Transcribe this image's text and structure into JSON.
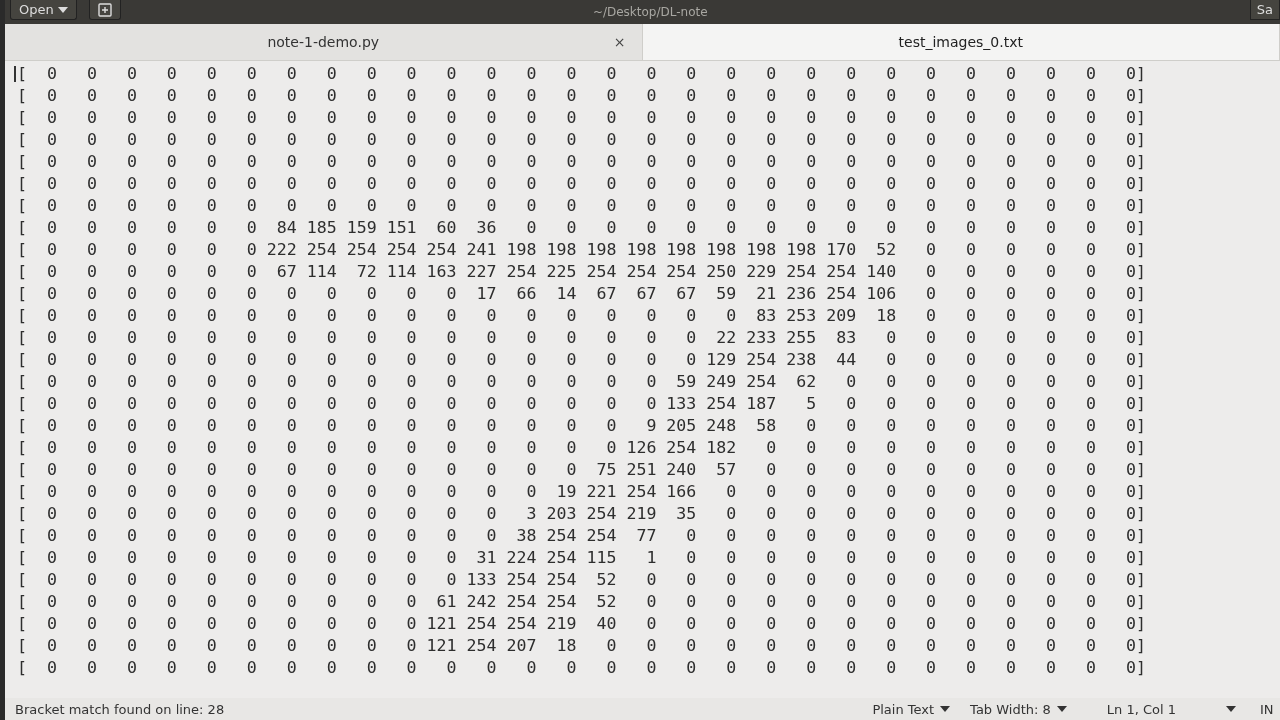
{
  "header": {
    "open_button": "Open",
    "subtitle": "~/Desktop/DL-note",
    "save_button": "Sa"
  },
  "tabs": [
    {
      "label": "note-1-demo.py",
      "close": "×",
      "selected": false
    },
    {
      "label": "test_images_0.txt",
      "selected": true
    }
  ],
  "editor": {
    "lines": [
      "[  0   0   0   0   0   0   0   0   0   0   0   0   0   0   0   0   0   0   0   0   0   0   0   0   0   0   0   0]",
      "[  0   0   0   0   0   0   0   0   0   0   0   0   0   0   0   0   0   0   0   0   0   0   0   0   0   0   0   0]",
      "[  0   0   0   0   0   0   0   0   0   0   0   0   0   0   0   0   0   0   0   0   0   0   0   0   0   0   0   0]",
      "[  0   0   0   0   0   0   0   0   0   0   0   0   0   0   0   0   0   0   0   0   0   0   0   0   0   0   0   0]",
      "[  0   0   0   0   0   0   0   0   0   0   0   0   0   0   0   0   0   0   0   0   0   0   0   0   0   0   0   0]",
      "[  0   0   0   0   0   0   0   0   0   0   0   0   0   0   0   0   0   0   0   0   0   0   0   0   0   0   0   0]",
      "[  0   0   0   0   0   0   0   0   0   0   0   0   0   0   0   0   0   0   0   0   0   0   0   0   0   0   0   0]",
      "[  0   0   0   0   0   0  84 185 159 151  60  36   0   0   0   0   0   0   0   0   0   0   0   0   0   0   0   0]",
      "[  0   0   0   0   0   0 222 254 254 254 254 241 198 198 198 198 198 198 198 198 170  52   0   0   0   0   0   0]",
      "[  0   0   0   0   0   0  67 114  72 114 163 227 254 225 254 254 254 250 229 254 254 140   0   0   0   0   0   0]",
      "[  0   0   0   0   0   0   0   0   0   0   0  17  66  14  67  67  67  59  21 236 254 106   0   0   0   0   0   0]",
      "[  0   0   0   0   0   0   0   0   0   0   0   0   0   0   0   0   0   0  83 253 209  18   0   0   0   0   0   0]",
      "[  0   0   0   0   0   0   0   0   0   0   0   0   0   0   0   0   0  22 233 255  83   0   0   0   0   0   0   0]",
      "[  0   0   0   0   0   0   0   0   0   0   0   0   0   0   0   0   0 129 254 238  44   0   0   0   0   0   0   0]",
      "[  0   0   0   0   0   0   0   0   0   0   0   0   0   0   0   0  59 249 254  62   0   0   0   0   0   0   0   0]",
      "[  0   0   0   0   0   0   0   0   0   0   0   0   0   0   0   0 133 254 187   5   0   0   0   0   0   0   0   0]",
      "[  0   0   0   0   0   0   0   0   0   0   0   0   0   0   0   9 205 248  58   0   0   0   0   0   0   0   0   0]",
      "[  0   0   0   0   0   0   0   0   0   0   0   0   0   0   0 126 254 182   0   0   0   0   0   0   0   0   0   0]",
      "[  0   0   0   0   0   0   0   0   0   0   0   0   0   0  75 251 240  57   0   0   0   0   0   0   0   0   0   0]",
      "[  0   0   0   0   0   0   0   0   0   0   0   0   0  19 221 254 166   0   0   0   0   0   0   0   0   0   0   0]",
      "[  0   0   0   0   0   0   0   0   0   0   0   0   3 203 254 219  35   0   0   0   0   0   0   0   0   0   0   0]",
      "[  0   0   0   0   0   0   0   0   0   0   0   0  38 254 254  77   0   0   0   0   0   0   0   0   0   0   0   0]",
      "[  0   0   0   0   0   0   0   0   0   0   0  31 224 254 115   1   0   0   0   0   0   0   0   0   0   0   0   0]",
      "[  0   0   0   0   0   0   0   0   0   0   0 133 254 254  52   0   0   0   0   0   0   0   0   0   0   0   0   0]",
      "[  0   0   0   0   0   0   0   0   0   0  61 242 254 254  52   0   0   0   0   0   0   0   0   0   0   0   0   0]",
      "[  0   0   0   0   0   0   0   0   0   0 121 254 254 219  40   0   0   0   0   0   0   0   0   0   0   0   0   0]",
      "[  0   0   0   0   0   0   0   0   0   0 121 254 207  18   0   0   0   0   0   0   0   0   0   0   0   0   0   0]",
      "[  0   0   0   0   0   0   0   0   0   0   0   0   0   0   0   0   0   0   0   0   0   0   0   0   0   0   0   0]"
    ]
  },
  "status_bar": {
    "message": "Bracket match found on line: 28",
    "language": "Plain Text",
    "tab_width": "Tab Width: 8",
    "position": "Ln 1, Col 1",
    "mode": "IN"
  }
}
